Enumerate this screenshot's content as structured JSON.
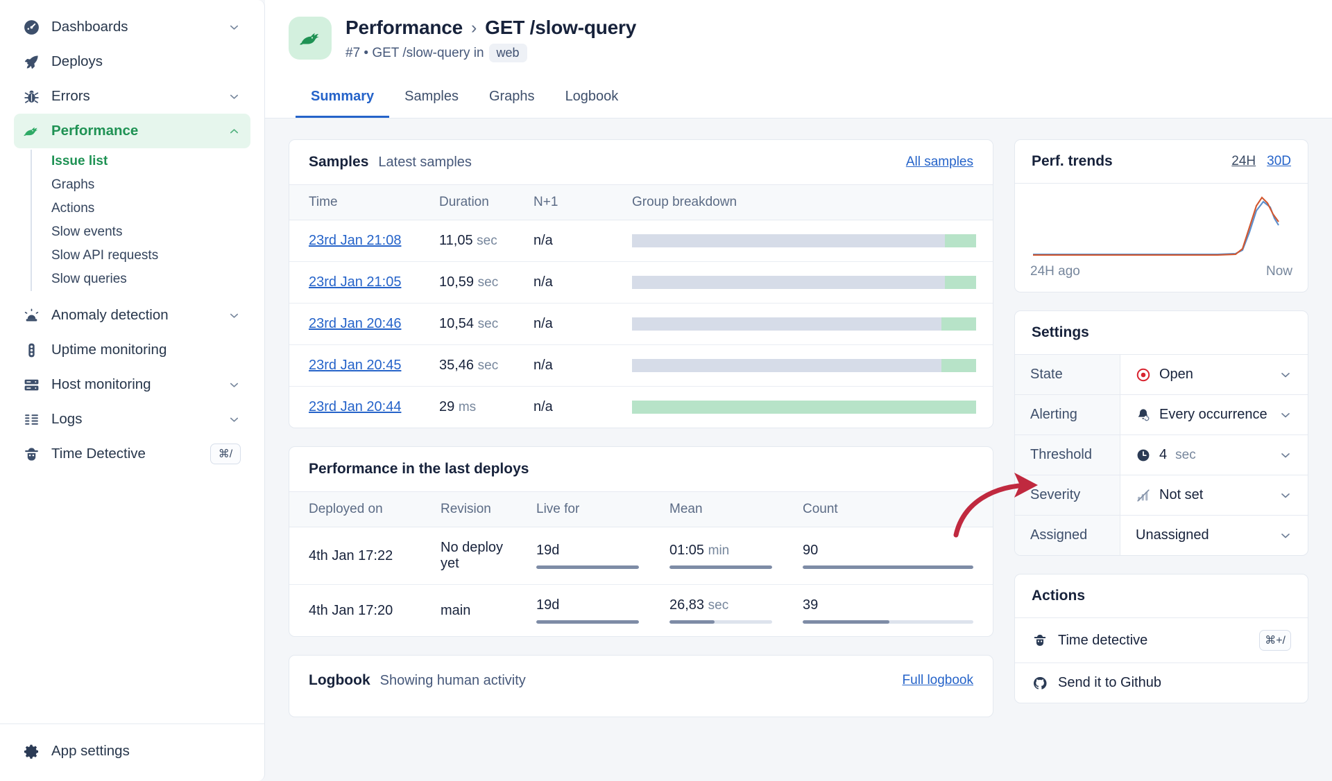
{
  "sidebar": {
    "items": [
      {
        "label": "Dashboards",
        "icon": "gauge-icon",
        "chevron": "down",
        "active": false
      },
      {
        "label": "Deploys",
        "icon": "rocket-icon",
        "chevron": "none",
        "active": false
      },
      {
        "label": "Errors",
        "icon": "bug-icon",
        "chevron": "down",
        "active": false
      },
      {
        "label": "Performance",
        "icon": "rabbit-icon",
        "chevron": "up",
        "active": true
      },
      {
        "label": "Anomaly detection",
        "icon": "siren-icon",
        "chevron": "down",
        "active": false
      },
      {
        "label": "Uptime monitoring",
        "icon": "traffic-light-icon",
        "chevron": "none",
        "active": false
      },
      {
        "label": "Host monitoring",
        "icon": "server-icon",
        "chevron": "down",
        "active": false
      },
      {
        "label": "Logs",
        "icon": "logs-icon",
        "chevron": "down",
        "active": false
      },
      {
        "label": "Time Detective",
        "icon": "detective-icon",
        "chevron": "none",
        "active": false,
        "shortcut": "⌘/"
      }
    ],
    "performance_subitems": [
      {
        "label": "Issue list",
        "selected": true
      },
      {
        "label": "Graphs",
        "selected": false
      },
      {
        "label": "Actions",
        "selected": false
      },
      {
        "label": "Slow events",
        "selected": false
      },
      {
        "label": "Slow API requests",
        "selected": false
      },
      {
        "label": "Slow queries",
        "selected": false
      }
    ],
    "footer": {
      "label": "App settings",
      "icon": "gear-icon"
    }
  },
  "header": {
    "avatar_icon": "rabbit-icon",
    "breadcrumb_parent": "Performance",
    "breadcrumb_sep": "›",
    "breadcrumb_current": "GET /slow-query",
    "subtitle_prefix": "#7 • GET /slow-query in",
    "subtitle_chip": "web",
    "tabs": [
      {
        "label": "Summary",
        "active": true
      },
      {
        "label": "Samples",
        "active": false
      },
      {
        "label": "Graphs",
        "active": false
      },
      {
        "label": "Logbook",
        "active": false
      }
    ]
  },
  "samples": {
    "title": "Samples",
    "subtitle": "Latest samples",
    "link": "All samples",
    "columns": [
      "Time",
      "Duration",
      "N+1",
      "Group breakdown"
    ],
    "rows": [
      {
        "time": "23rd Jan 21:08",
        "duration": "11,05",
        "unit": "sec",
        "n1": "n/a",
        "grey_pct": 91,
        "green_pct": 9
      },
      {
        "time": "23rd Jan 21:05",
        "duration": "10,59",
        "unit": "sec",
        "n1": "n/a",
        "grey_pct": 91,
        "green_pct": 9
      },
      {
        "time": "23rd Jan 20:46",
        "duration": "10,54",
        "unit": "sec",
        "n1": "n/a",
        "grey_pct": 90,
        "green_pct": 10
      },
      {
        "time": "23rd Jan 20:45",
        "duration": "35,46",
        "unit": "sec",
        "n1": "n/a",
        "grey_pct": 90,
        "green_pct": 10
      },
      {
        "time": "23rd Jan 20:44",
        "duration": "29",
        "unit": "ms",
        "n1": "n/a",
        "grey_pct": 0,
        "green_pct": 100
      }
    ]
  },
  "deploys": {
    "title": "Performance in the last deploys",
    "columns": [
      "Deployed on",
      "Revision",
      "Live for",
      "Mean",
      "Count"
    ],
    "rows": [
      {
        "deployed_on": "4th Jan 17:22",
        "revision": "No deploy yet",
        "live_for": "19d",
        "live_for_pct": 100,
        "mean": "01:05",
        "mean_unit": "min",
        "mean_pct": 100,
        "count": "90",
        "count_pct": 100
      },
      {
        "deployed_on": "4th Jan 17:20",
        "revision": "main",
        "live_for": "19d",
        "live_for_pct": 100,
        "mean": "26,83",
        "mean_unit": "sec",
        "mean_pct": 44,
        "count": "39",
        "count_pct": 51
      }
    ]
  },
  "logbook": {
    "title": "Logbook",
    "subtitle": "Showing human activity",
    "link": "Full logbook"
  },
  "perf_trends": {
    "title": "Perf. trends",
    "range_24h": "24H",
    "range_30d": "30D",
    "axis_left": "24H ago",
    "axis_right": "Now"
  },
  "settings": {
    "title": "Settings",
    "rows": [
      {
        "key": "State",
        "value": "Open",
        "icon": "record-circle-icon",
        "icon_color": "#d8232f"
      },
      {
        "key": "Alerting",
        "value": "Every occurrence",
        "icon": "bell-repeat-icon",
        "icon_color": "#2b3b55"
      },
      {
        "key": "Threshold",
        "value": "4",
        "unit": "sec",
        "icon": "clock-icon",
        "icon_color": "#2b3b55"
      },
      {
        "key": "Severity",
        "value": "Not set",
        "icon": "severity-off-icon",
        "icon_color": "#aab5c6"
      },
      {
        "key": "Assigned",
        "value": "Unassigned",
        "icon": "none",
        "icon_color": "#2b3b55"
      }
    ]
  },
  "actions": {
    "title": "Actions",
    "items": [
      {
        "label": "Time detective",
        "icon": "detective-icon",
        "shortcut": "⌘+/"
      },
      {
        "label": "Send it to Github",
        "icon": "github-icon",
        "shortcut": ""
      }
    ]
  },
  "annotation": {
    "type": "curved-arrow",
    "color": "#c0293f",
    "points_to": "Threshold"
  },
  "chart_data": {
    "type": "line",
    "title": "Perf. trends",
    "xlabel": "",
    "ylabel": "",
    "x": [
      0,
      10,
      20,
      30,
      40,
      50,
      60,
      70,
      80,
      82,
      85,
      88,
      91,
      94,
      97,
      100
    ],
    "series": [
      {
        "name": "mean",
        "color": "#d2572f",
        "values": [
          3,
          3,
          3,
          3,
          3,
          3,
          3,
          3,
          3,
          5,
          30,
          62,
          80,
          70,
          48,
          40
        ]
      },
      {
        "name": "p95",
        "color": "#5b8ecb",
        "values": [
          3,
          3,
          3,
          3,
          3,
          3,
          3,
          3,
          3,
          4,
          26,
          55,
          72,
          62,
          42,
          34
        ]
      }
    ],
    "xticklabels": [
      "24H ago",
      "Now"
    ],
    "grid": false,
    "legend": "none"
  }
}
